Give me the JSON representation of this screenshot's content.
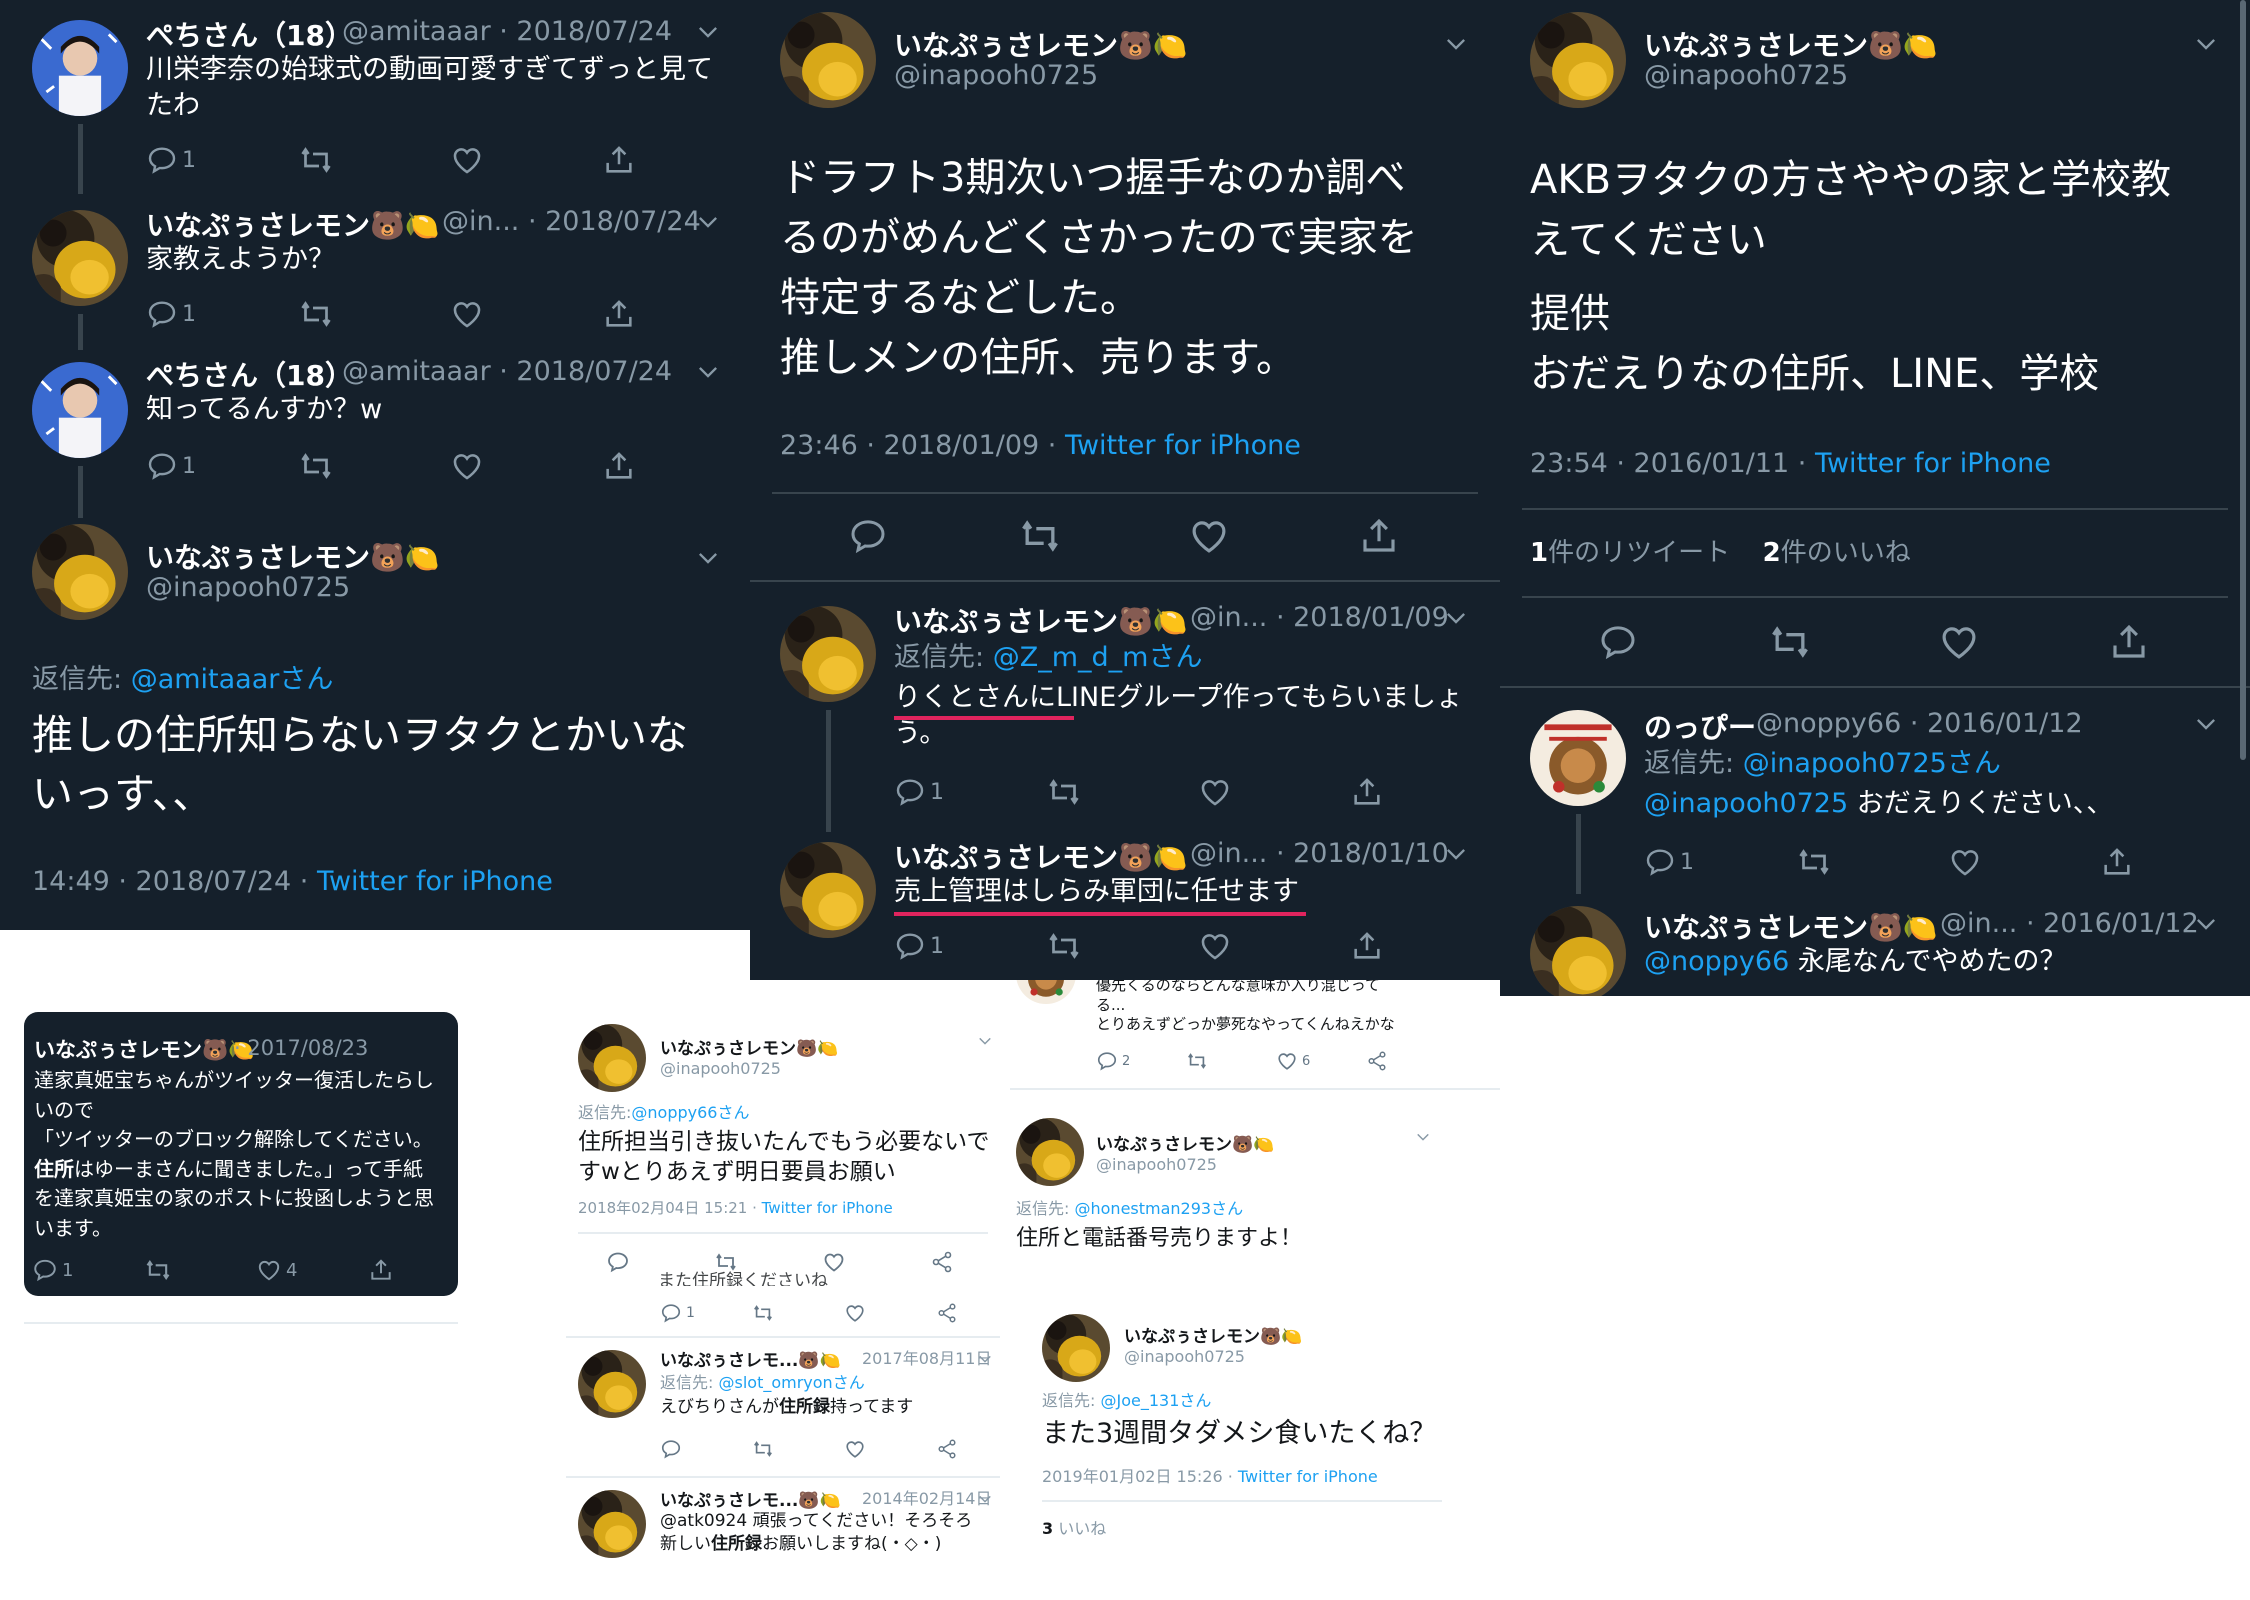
{
  "emoji": "🐻🍋",
  "panel_a": {
    "tweets": [
      {
        "name": "ぺちさん（18）",
        "handle": "@amitaaar",
        "date": "2018/07/24",
        "text_line1": "川栄李奈の始球式の動画可愛すぎてずっと見て",
        "text_line2": "たわ",
        "reply_count": "1"
      },
      {
        "name": "いなぷぅさレモン",
        "handle": "@in...",
        "date": "2018/07/24",
        "text": "家教えようか？",
        "reply_count": "1"
      },
      {
        "name": "ぺちさん（18）",
        "handle": "@amitaaar",
        "date": "2018/07/24",
        "text": "知ってるんすか？w",
        "reply_count": "1"
      }
    ],
    "main": {
      "name": "いなぷぅさレモン",
      "handle": "@inapooh0725",
      "reply_label": "返信先:",
      "reply_to": "@amitaaarさん",
      "text_line1": "推しの住所知らないヲタクとかいな",
      "text_line2": "いっす、、",
      "time": "14:49 · 2018/07/24 ·",
      "client": "Twitter for iPhone"
    }
  },
  "panel_b": {
    "main": {
      "name": "いなぷぅさレモン",
      "handle": "@inapooh0725",
      "text_line1": "ドラフト3期次いつ握手なのか調べ",
      "text_line2": "るのがめんどくさかったので実家を",
      "text_line3": "特定するなどした。",
      "text_line4": "推しメンの住所、売ります。",
      "time": "23:46 · 2018/01/09 ·",
      "client": "Twitter for iPhone"
    },
    "replies": [
      {
        "name": "いなぷぅさレモン",
        "handle": "@in...",
        "date": "2018/01/09",
        "reply_label": "返信先:",
        "reply_to": "@Z_m_d_mさん",
        "text_line1": "りくとさんにLINEグループ作ってもらいましょ",
        "text_line2": "う。",
        "reply_count": "1"
      },
      {
        "name": "いなぷぅさレモン",
        "handle": "@in...",
        "date": "2018/01/10",
        "text": "売上管理はしらみ軍団に任せます",
        "reply_count": "1"
      }
    ]
  },
  "panel_c": {
    "main": {
      "name": "いなぷぅさレモン",
      "handle": "@inapooh0725",
      "text_line1": "AKBヲタクの方さややの家と学校教",
      "text_line2": "えてください",
      "text_line3": "提供",
      "text_line4": "おだえりなの住所、LINE、学校",
      "time": "23:54 · 2016/01/11 ·",
      "client": "Twitter for iPhone",
      "retweets_num": "1",
      "retweets_label": "件のリツイート",
      "likes_num": "2",
      "likes_label": "件のいいね"
    },
    "replies": [
      {
        "name": "のっぴー",
        "handle": "@noppy66",
        "date": "2016/01/12",
        "reply_label": "返信先:",
        "reply_to": "@inapooh0725さん",
        "mention": "@inapooh0725",
        "text": "おだえりください、、",
        "reply_count": "1"
      },
      {
        "name": "いなぷぅさレモン",
        "handle": "@in...",
        "date": "2016/01/12",
        "mention": "@noppy66",
        "text": "永尾なんでやめたの？"
      }
    ]
  },
  "panel_d": {
    "name": "いなぷぅさレモン",
    "date": "2017/08/23",
    "line1": "達家真姫宝ちゃんがツイッター復活したらし",
    "line2": "いので",
    "line3": "「ツイッターのブロック解除してください。",
    "line4_bold": "住所",
    "line4": "はゆーまさんに聞きました。」って手紙",
    "line5": "を達家真姫宝の家のポストに投函しようと思",
    "line6": "います。",
    "reply_count": "1",
    "like_count": "4"
  },
  "panel_e": {
    "main": {
      "name": "いなぷぅさレモン",
      "handle": "@inapooh0725",
      "reply_label": "返信先:",
      "reply_to": "@noppy66さん",
      "text_line1": "住所担当引き抜いたんでもう必要ないで",
      "text_line2": "すwとりあえず明日要員お願い",
      "time": "2018年02月04日 15:21 ·",
      "client": "Twitter for iPhone"
    },
    "partial_text": "また住所録くださいね",
    "reply_count": "1",
    "replies": [
      {
        "name": "いなぷぅさレモ...",
        "date": "2017年08月11日",
        "reply_label": "返信先:",
        "reply_to": "@slot_omryonさん",
        "text_pre": "えびちりさんが",
        "text_bold": "住所録",
        "text_post": "持ってます"
      },
      {
        "name": "いなぷぅさレモ...",
        "date": "2014年02月14日",
        "mention": "@atk0924",
        "text1": "頑張ってください！そろそろ",
        "text2_pre": "新しい",
        "text2_bold": "住所録",
        "text2_post": "お願いしますね(・◇・)"
      }
    ]
  },
  "panel_f": {
    "top_line1": "優先くるのならどんな意味が入り混じって",
    "top_line2": "る...",
    "top_line3": "とりあえずどっか夢死なやってくんねえかな",
    "top_reply_count": "2",
    "top_like_count": "6",
    "t1": {
      "name": "いなぷぅさレモン",
      "handle": "@inapooh0725",
      "reply_label": "返信先:",
      "reply_to": "@honestman293さん",
      "text": "住所と電話番号売りますよ！"
    },
    "t2": {
      "name": "いなぷぅさレモン",
      "handle": "@inapooh0725",
      "reply_label": "返信先:",
      "reply_to": "@Joe_131さん",
      "text": "また3週間タダメシ食いたくね？",
      "time": "2019年01月02日 15:26 ·",
      "client": "Twitter for iPhone",
      "likes_num": "3",
      "likes_label": "いいね"
    }
  },
  "colors": {
    "dark_bg": "#15202b",
    "link": "#1da1f2",
    "muted": "#8899a6",
    "underline": "#e0245e"
  }
}
